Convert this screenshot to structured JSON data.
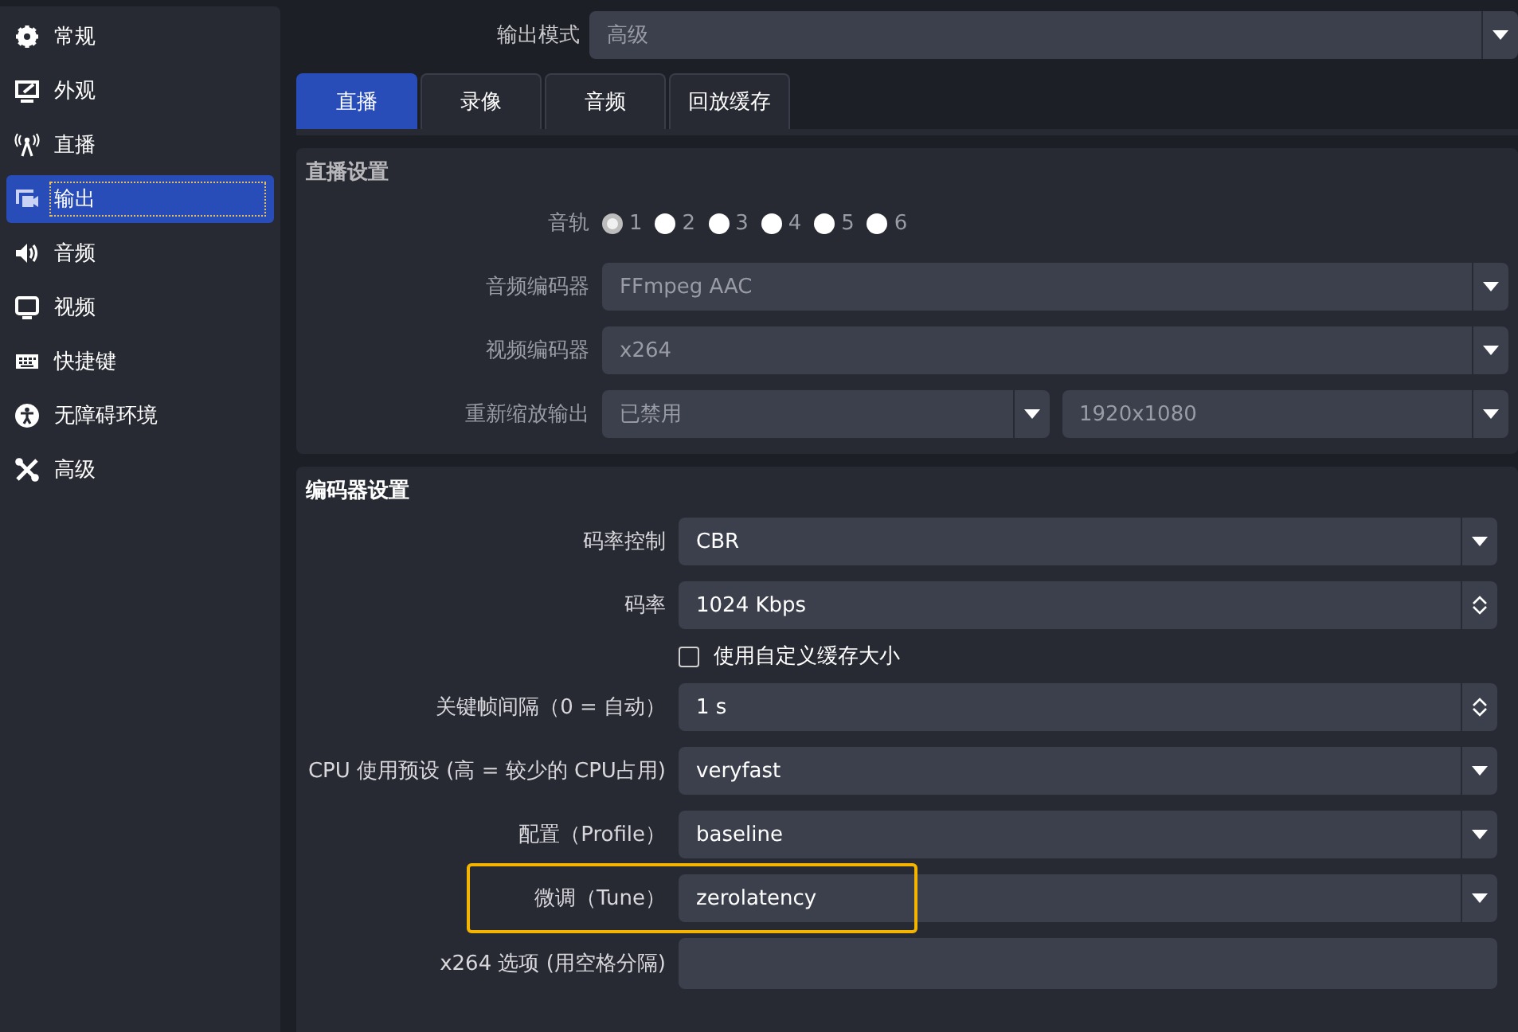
{
  "sidebar": {
    "items": [
      {
        "label": "常规",
        "selected": false
      },
      {
        "label": "外观",
        "selected": false
      },
      {
        "label": "直播",
        "selected": false
      },
      {
        "label": "输出",
        "selected": true
      },
      {
        "label": "音频",
        "selected": false
      },
      {
        "label": "视频",
        "selected": false
      },
      {
        "label": "快捷键",
        "selected": false
      },
      {
        "label": "无障碍环境",
        "selected": false
      },
      {
        "label": "高级",
        "selected": false
      }
    ]
  },
  "output_mode": {
    "label": "输出模式",
    "value": "高级"
  },
  "tabs": [
    {
      "label": "直播",
      "selected": true
    },
    {
      "label": "录像",
      "selected": false
    },
    {
      "label": "音频",
      "selected": false
    },
    {
      "label": "回放缓存",
      "selected": false
    }
  ],
  "sections": [
    {
      "title": "直播设置",
      "disabled": true,
      "rows": [
        {
          "kind": "radios",
          "label": "音轨",
          "options": [
            {
              "label": "1",
              "selected": true
            },
            {
              "label": "2",
              "selected": false
            },
            {
              "label": "3",
              "selected": false
            },
            {
              "label": "4",
              "selected": false
            },
            {
              "label": "5",
              "selected": false
            },
            {
              "label": "6",
              "selected": false
            }
          ]
        },
        {
          "kind": "select",
          "label": "音频编码器",
          "value": "FFmpeg AAC"
        },
        {
          "kind": "select",
          "label": "视频编码器",
          "value": "x264"
        },
        {
          "kind": "dual_select",
          "label": "重新缩放输出",
          "values": [
            "已禁用",
            "1920x1080"
          ]
        }
      ]
    },
    {
      "title": "编码器设置",
      "disabled": false,
      "rows": [
        {
          "kind": "select",
          "label": "码率控制",
          "value": "CBR"
        },
        {
          "kind": "spin",
          "label": "码率",
          "value": "1024 Kbps"
        },
        {
          "kind": "checkbox",
          "text": "使用自定义缓存大小",
          "checked": false
        },
        {
          "kind": "spin",
          "label": "关键帧间隔（0 = 自动）",
          "value": "1 s"
        },
        {
          "kind": "select",
          "label": "CPU 使用预设 (高 = 较少的 CPU占用)",
          "value": "veryfast"
        },
        {
          "kind": "select",
          "label": "配置（Profile）",
          "value": "baseline"
        },
        {
          "kind": "select",
          "label": "微调（Tune）",
          "value": "zerolatency",
          "highlighted": true
        },
        {
          "kind": "text",
          "label": "x264 选项 (用空格分隔)"
        }
      ]
    }
  ]
}
